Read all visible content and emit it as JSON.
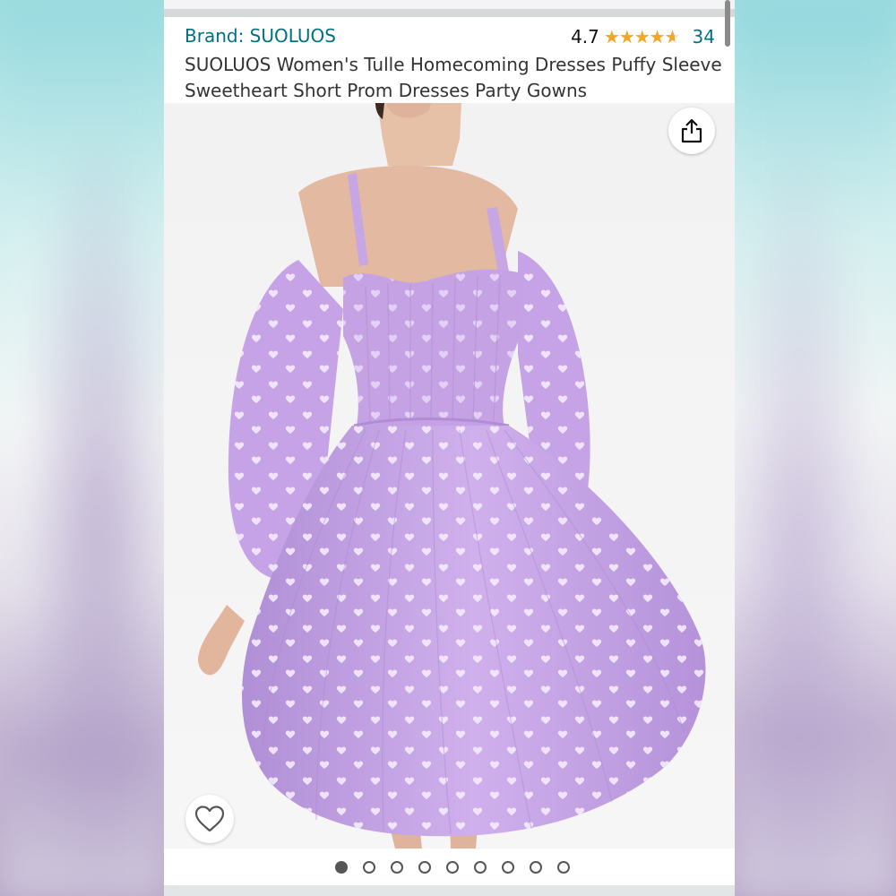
{
  "product": {
    "brand": "Brand: SUOLUOS",
    "rating_value": "4.7",
    "rating_fraction": 0.94,
    "stars_glyphs": "★★★★★",
    "review_count": "34",
    "title": "SUOLUOS Women's Tulle Homecoming Dresses Puffy Sleeve Sweetheart Short Prom Dresses Party Gowns"
  },
  "icons": {
    "share": "share-icon",
    "wishlist": "heart-outline-icon",
    "star": "star-icon"
  },
  "carousel": {
    "total": 9,
    "active_index": 0
  },
  "colors": {
    "link": "#007185",
    "star": "#f5a623",
    "dress": "#c8a6e4"
  }
}
